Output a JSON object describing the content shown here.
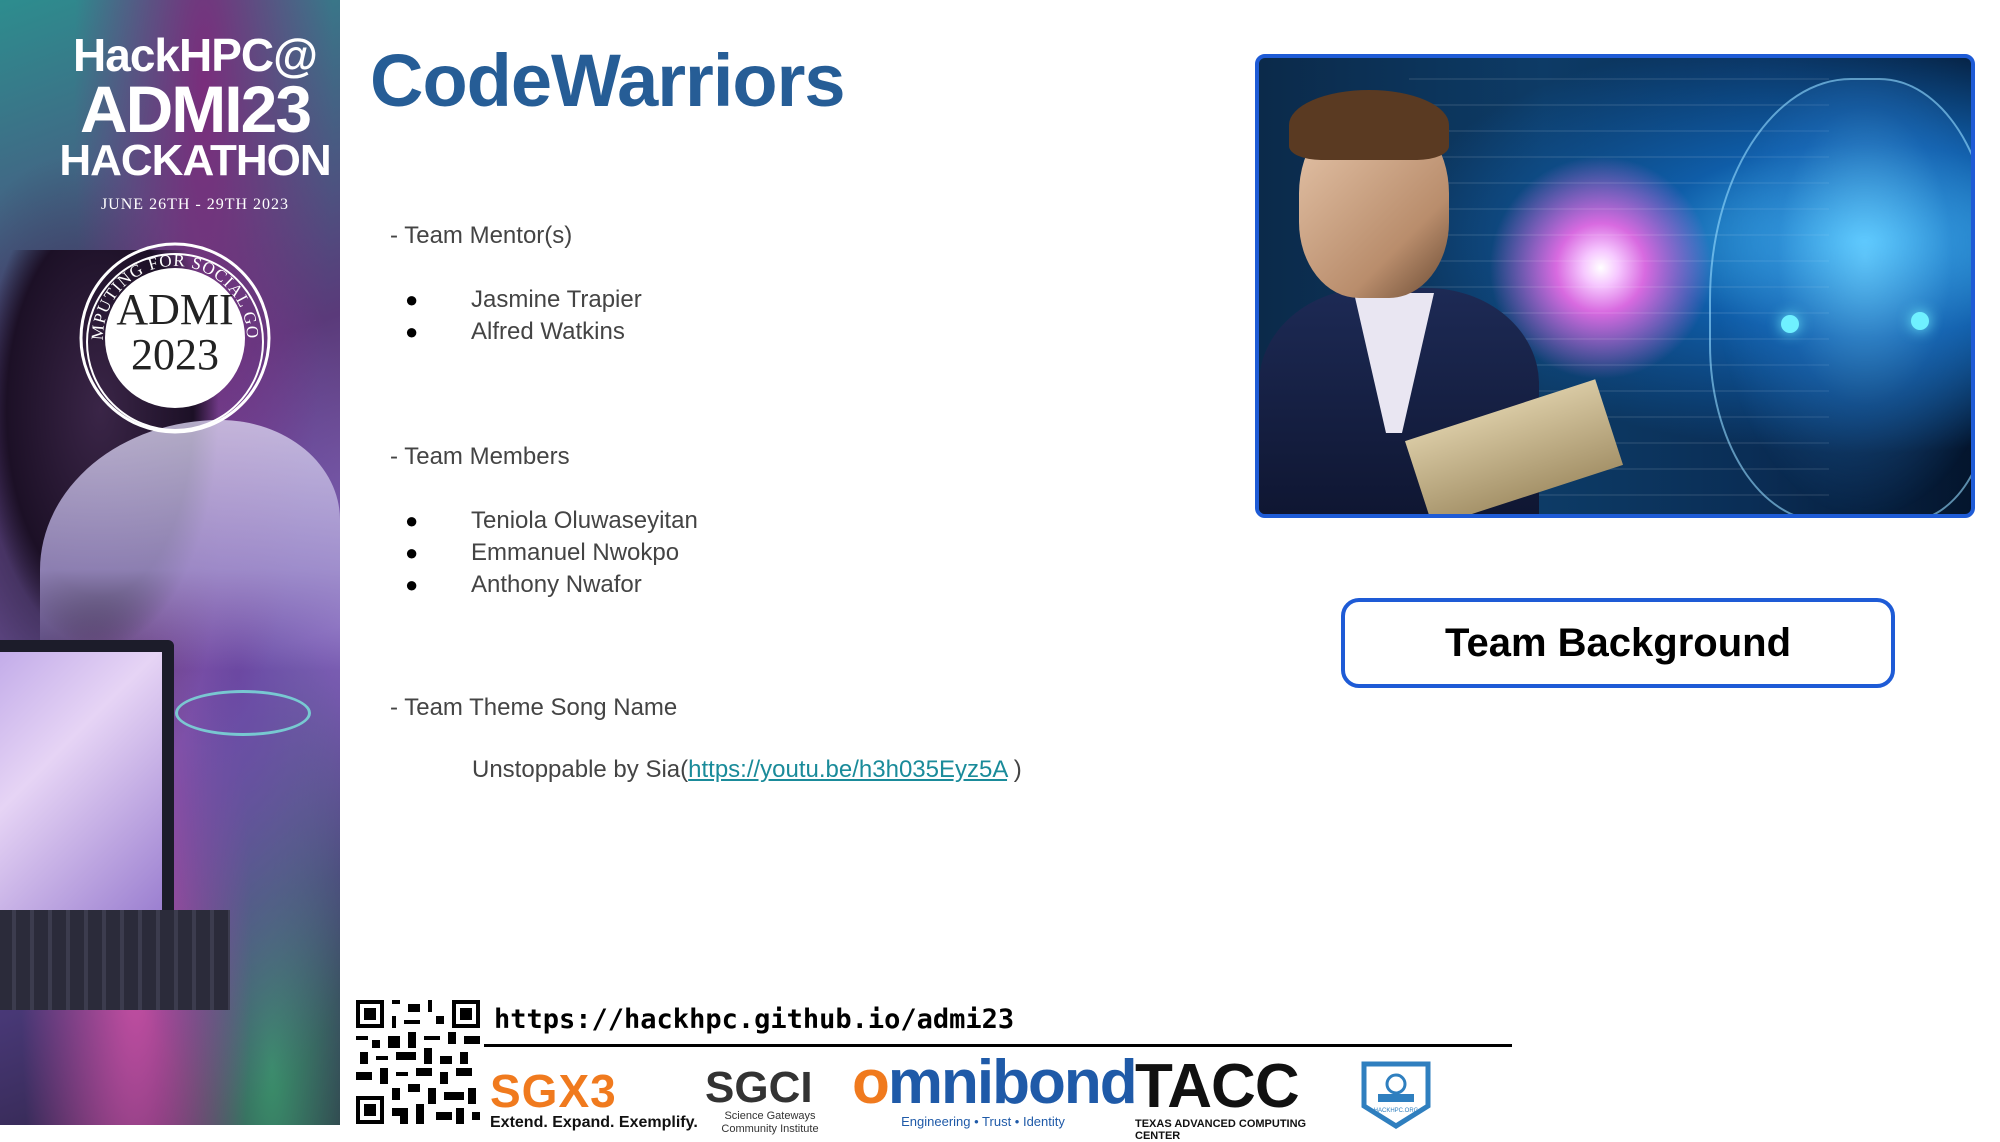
{
  "banner": {
    "line1": "HackHPC@",
    "line2": "ADMI23",
    "line3": "HACKATHON",
    "dates": "JUNE 26TH - 29TH 2023",
    "seal_arc": "COMPUTING FOR SOCIAL GOOD",
    "seal_line1": "ADMI",
    "seal_line2": "2023"
  },
  "title": "CodeWarriors",
  "mentors": {
    "label": "- Team Mentor(s)",
    "names": [
      "Jasmine Trapier",
      "Alfred Watkins"
    ]
  },
  "members": {
    "label": "- Team Members",
    "names": [
      "Teniola Oluwaseyitan",
      "Emmanuel Nwokpo",
      "Anthony Nwafor"
    ]
  },
  "song": {
    "label": "- Team Theme Song Name",
    "prefix": "Unstoppable by Sia(",
    "link": "https://youtu.be/h3h035Eyz5A",
    "suffix": " )"
  },
  "bullet": "●",
  "team_background_button": "Team Background",
  "footer": {
    "url": "https://hackhpc.github.io/admi23",
    "sgx3": {
      "name": "SGX3",
      "tagline": "Extend. Expand. Exemplify."
    },
    "sgci": {
      "name": "SGCI",
      "sub1": "Science Gateways",
      "sub2": "Community Institute"
    },
    "omnibond": {
      "name": "mnibond",
      "first_letter": "o",
      "tagline": "Engineering  •  Trust  •  Identity"
    },
    "tacc": {
      "name": "TACC",
      "sub": "TEXAS ADVANCED COMPUTING CENTER"
    },
    "hackhpc_badge": "HACKHPC.ORG"
  },
  "colors": {
    "title": "#265d96",
    "accent_border": "#1e5bd6",
    "link": "#1a8b9a",
    "sgx_orange": "#f07a1e",
    "omnibond_blue": "#1f5aa8"
  },
  "icons": {
    "bullet": "bullet-dot-icon",
    "qr": "qr-code-icon",
    "badge": "hackhpc-shield-icon"
  }
}
